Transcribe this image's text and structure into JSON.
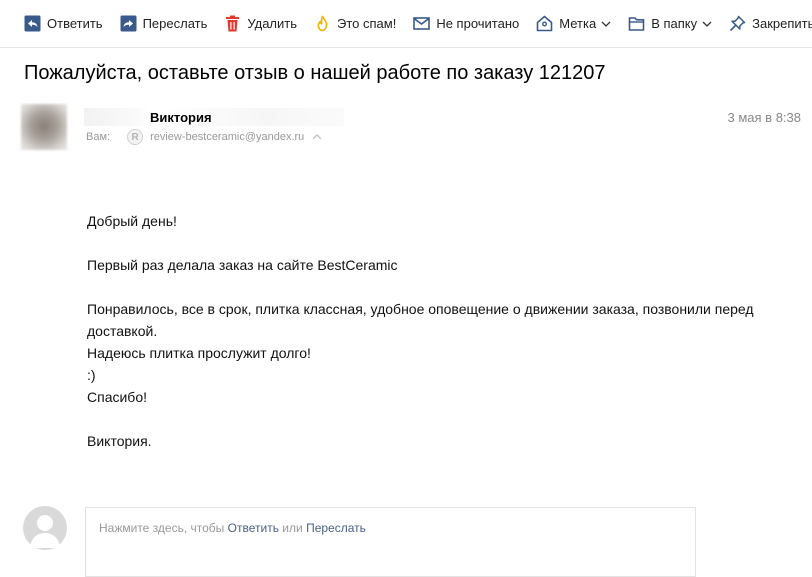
{
  "toolbar": {
    "reply_label": "Ответить",
    "forward_label": "Переслать",
    "delete_label": "Удалить",
    "spam_label": "Это спам!",
    "unread_label": "Не прочитано",
    "tag_label": "Метка",
    "folder_label": "В папку",
    "pin_label": "Закрепить"
  },
  "message": {
    "subject": "Пожалуйста, оставьте отзыв о нашей работе по заказу 121207",
    "sender_name": "Виктория",
    "to_label": "Вам:",
    "to_icon_letter": "R",
    "to_address": "review-bestceramic@yandex.ru",
    "date": "3 мая в 8:38",
    "body": {
      "greeting": "Добрый день!",
      "line1": "Первый раз делала заказ на сайте BestCeramic",
      "line2": "Понравилось, все в срок, плитка классная, удобное оповещение о движении заказа, позвонили перед доставкой.",
      "line3": "Надеюсь плитка прослужит долго!",
      "line4": ":)",
      "line5": "Спасибо!",
      "signature": "Виктория."
    }
  },
  "quick_reply": {
    "hint_prefix": "Нажмите здесь, чтобы",
    "reply_link": "Ответить",
    "or_text": "или",
    "forward_link": "Переслать"
  },
  "colors": {
    "icon_blue": "#3a5a8c",
    "delete_red": "#e03a2f",
    "spam_yellow": "#f0b400",
    "link_blue": "#4a5f88"
  },
  "icons": {
    "reply": "reply-icon",
    "forward": "forward-icon",
    "delete": "trash-icon",
    "spam": "thumbs-down-icon",
    "unread": "envelope-icon",
    "tag": "tag-icon",
    "folder": "folder-icon",
    "pin": "pin-icon"
  }
}
